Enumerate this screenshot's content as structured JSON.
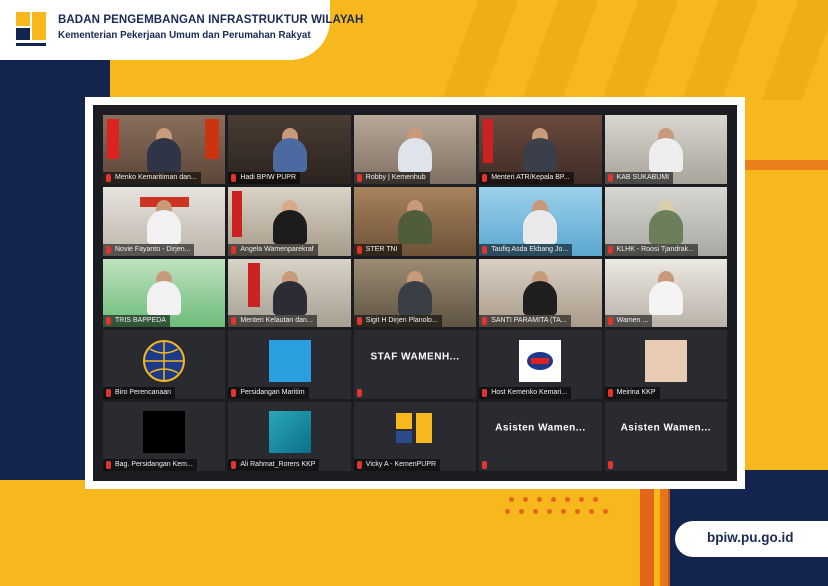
{
  "header": {
    "org_title": "BADAN PENGEMBANGAN INFRASTRUKTUR WILAYAH",
    "org_subtitle": "Kementerian Pekerjaan Umum dan Perumahan Rakyat",
    "logo_text": "PUPR"
  },
  "footer": {
    "website": "bpiw.pu.go.id"
  },
  "meeting": {
    "tiles": [
      {
        "name": "Menko Kemaritiman dan...",
        "avatar": ""
      },
      {
        "name": "Hadi BPIW PUPR",
        "avatar": ""
      },
      {
        "name": "Robby | Kemenhub",
        "avatar": ""
      },
      {
        "name": "Menteri ATR/Kepala BP...",
        "avatar": ""
      },
      {
        "name": "KAB SUKABUMI",
        "avatar": ""
      },
      {
        "name": "Novie Fayanto - Dirjen...",
        "avatar": ""
      },
      {
        "name": "Angela Wamenparekraf",
        "avatar": ""
      },
      {
        "name": "STER TNI",
        "avatar": ""
      },
      {
        "name": "Taufiq Asda Ekbang Jo...",
        "avatar": ""
      },
      {
        "name": "KLHK - Roosi Tjandrak...",
        "avatar": ""
      },
      {
        "name": "TRIS BAPPEDA",
        "avatar": ""
      },
      {
        "name": "Menteri Kelautan dan...",
        "avatar": ""
      },
      {
        "name": "Sigit H Dirjen Planolo...",
        "avatar": ""
      },
      {
        "name": "SANTI PARAMITA (TA...",
        "avatar": ""
      },
      {
        "name": "Wamen ...",
        "avatar": ""
      },
      {
        "name": "Biro Perencanaan",
        "avatar": ""
      },
      {
        "name": "Persidangan Maritim",
        "avatar": ""
      },
      {
        "name": "",
        "avatar": "STAF WAMENH..."
      },
      {
        "name": "Host Kemenko Kemari...",
        "avatar": ""
      },
      {
        "name": "Meirina KKP",
        "avatar": ""
      },
      {
        "name": "Bag. Persidangan Kem...",
        "avatar": ""
      },
      {
        "name": "Ali Rahmat_Rorers KKP",
        "avatar": ""
      },
      {
        "name": "Vicky A - KemenPUPR",
        "avatar": ""
      },
      {
        "name": "",
        "avatar": "Asisten Wamen..."
      },
      {
        "name": "",
        "avatar": "Asisten Wamen..."
      }
    ]
  },
  "colors": {
    "brand_yellow": "#f6b81c",
    "brand_navy": "#13254f",
    "accent_orange": "#e4651a",
    "active_speaker": "#e6e24a"
  }
}
